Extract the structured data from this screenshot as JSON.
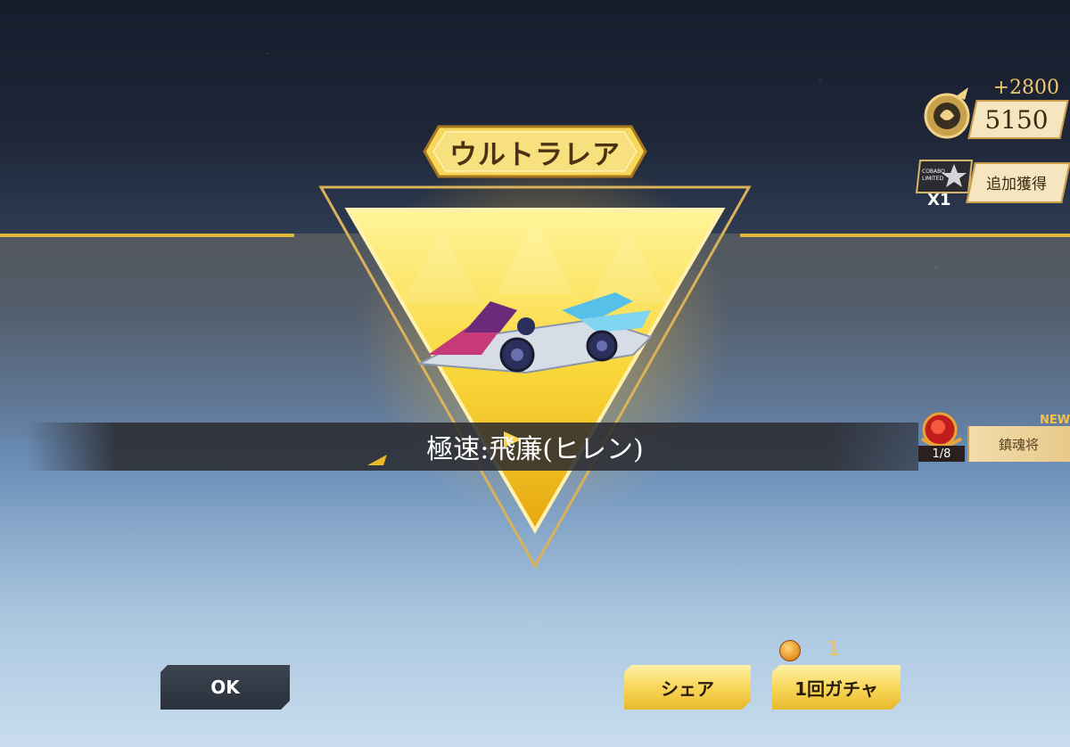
{
  "rarity": {
    "label": "ウルトラレア"
  },
  "item": {
    "name": "極速:飛廉(ヒレン)"
  },
  "currency": {
    "delta": "+2800",
    "value": "5150",
    "icon": "dragon-emblem-icon"
  },
  "bonus": {
    "label": "追加獲得",
    "count": "X1",
    "card_icon": "collab-limited-card-icon",
    "card_text_1": "COBABO",
    "card_text_2": "LIMITED"
  },
  "recipe": {
    "new_tag": "NEW",
    "label": "鎮魂将",
    "progress": "1/8",
    "icon": "red-gem-icon"
  },
  "buttons": {
    "ok": "OK",
    "share": "シェア",
    "gacha": "1回ガチャ"
  },
  "gacha_cost": {
    "value": "1",
    "icon": "gacha-coin-icon"
  },
  "colors": {
    "gold": "#f8d455",
    "dark": "#2a313c",
    "accent": "#e2b73c"
  }
}
